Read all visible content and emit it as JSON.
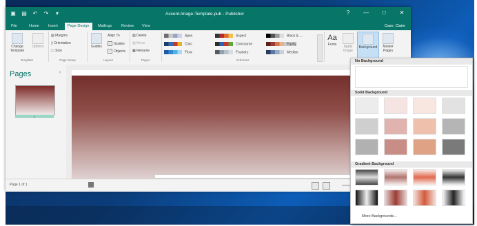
{
  "window": {
    "title": "Accent-Image-Template.pub - Publisher",
    "help": "?",
    "controls": [
      "—",
      "□",
      "✕"
    ]
  },
  "tabs": [
    {
      "label": "File",
      "active": false
    },
    {
      "label": "Home",
      "active": false
    },
    {
      "label": "Insert",
      "active": false
    },
    {
      "label": "Page Design",
      "active": true
    },
    {
      "label": "Mailings",
      "active": false
    },
    {
      "label": "Review",
      "active": false
    },
    {
      "label": "View",
      "active": false
    }
  ],
  "account": "Case, Claire",
  "ribbon": {
    "template": {
      "change_label": "Change Template",
      "options_label": "Options",
      "group_label": "Template"
    },
    "page_setup": {
      "margins": "Margins",
      "orientation": "Orientation",
      "size": "Size",
      "group_label": "Page Setup"
    },
    "layout": {
      "guides": "Guides",
      "align_to": "Align To",
      "guides_chk": "Guides",
      "objects_chk": "Objects",
      "group_label": "Layout"
    },
    "pages": {
      "delete": "Delete",
      "move": "Move",
      "rename": "Rename",
      "group_label": "Pages"
    },
    "schemes": {
      "group_label": "Schemes",
      "items": [
        {
          "name": "Apex",
          "colors": [
            "#6e6e6e",
            "#c9c9c9",
            "#9aa5c8",
            "#ced2e6"
          ],
          "selected": false
        },
        {
          "name": "Civic",
          "colors": [
            "#1f3b6a",
            "#2f6fb0",
            "#c7332e",
            "#e6b324"
          ],
          "selected": false
        },
        {
          "name": "Flow",
          "colors": [
            "#1f5aa8",
            "#2f89d4",
            "#4bb3e6",
            "#a9d8f2"
          ],
          "selected": false
        },
        {
          "name": "Aspect",
          "colors": [
            "#333333",
            "#b52c2c",
            "#e26b2b",
            "#f2c04d"
          ],
          "selected": false
        },
        {
          "name": "Concourse",
          "colors": [
            "#2c2c2c",
            "#2a62b5",
            "#c5352a",
            "#5fa43b"
          ],
          "selected": false
        },
        {
          "name": "Foundry",
          "colors": [
            "#5a5a5a",
            "#8fa3b6",
            "#b7c2cc",
            "#d7dde3"
          ],
          "selected": false
        },
        {
          "name": "Black & ...",
          "colors": [
            "#000000",
            "#555555",
            "#999999",
            "#dddddd"
          ],
          "selected": false
        },
        {
          "name": "Equity",
          "colors": [
            "#5c1f1f",
            "#9c3b33",
            "#d1774b",
            "#e8b087"
          ],
          "selected": true
        },
        {
          "name": "Median",
          "colors": [
            "#2b3a5c",
            "#5b7aa8",
            "#9aaac2",
            "#c9d1dd"
          ],
          "selected": false
        }
      ]
    },
    "fonts": {
      "label": "Fonts",
      "glyph": "Aa"
    },
    "apply_image": "Apply Image",
    "background": "Background",
    "master_pages": "Master Pages"
  },
  "pages_pane": {
    "title": "Pages",
    "thumb_number": "1"
  },
  "status": {
    "page": "Page 1 of 1"
  },
  "gallery": {
    "no_bg_title": "No Background",
    "solid_title": "Solid Background",
    "gradient_title": "Gradient Background",
    "more_label": "More Backgrounds...",
    "solid_colors": [
      "#ececec",
      "#f5e4e2",
      "#f8e6e0",
      "#e2e2e2",
      "#cfcfcf",
      "#e0b3ae",
      "#efc1ad",
      "#b5b5b5",
      "#b1b1b1",
      "#c98d87",
      "#e0a285",
      "#7a7a7a"
    ],
    "gradient_rows": [
      [
        "linear-gradient(#444,#ddd,#444)",
        "linear-gradient(#f6eceb,#b07570,#f6eceb)",
        "linear-gradient(#f8ece6,#e06a4f,#f8ece6)",
        "linear-gradient(#f0f0f0,#333,#f0f0f0)"
      ],
      [
        "linear-gradient(90deg,#111,#eee,#111)",
        "linear-gradient(90deg,#e6d6d4,#9c3b33,#e6d6d4)",
        "linear-gradient(90deg,#f3e1da,#d35a3c,#f3e1da)",
        "linear-gradient(90deg,#fff,#222,#fff)"
      ]
    ]
  }
}
